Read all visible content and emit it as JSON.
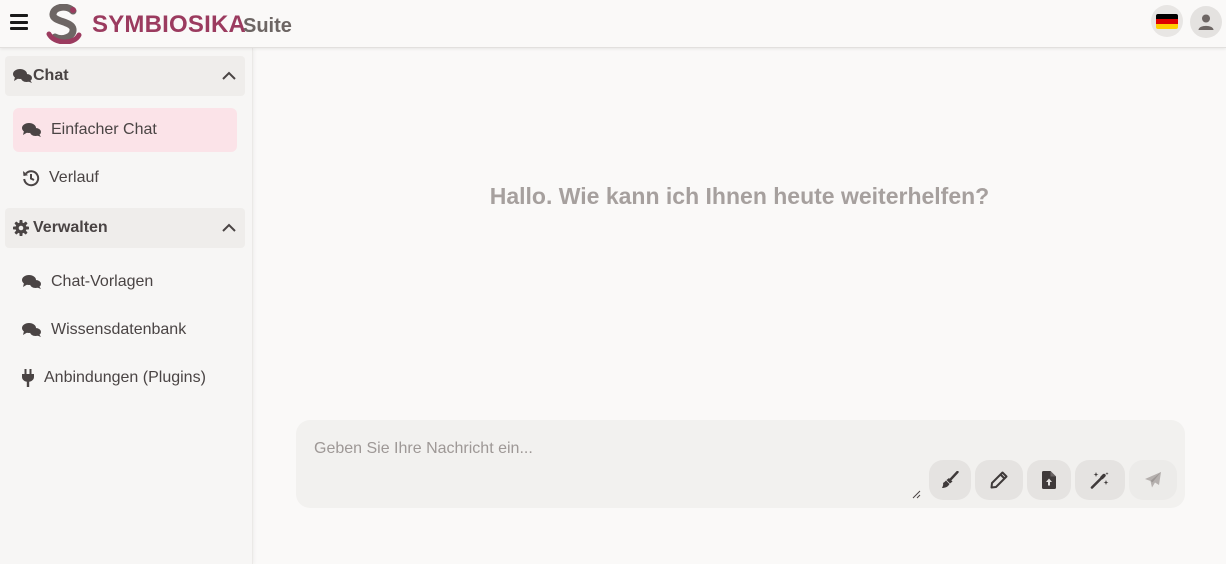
{
  "header": {
    "brand": "SYMBIOSIKA",
    "brand_suffix": "Suite"
  },
  "sidebar": {
    "sections": [
      {
        "label": "Chat",
        "icon": "comments-icon",
        "items": [
          {
            "label": "Einfacher Chat",
            "icon": "comments-icon",
            "active": true
          },
          {
            "label": "Verlauf",
            "icon": "history-icon",
            "active": false
          }
        ]
      },
      {
        "label": "Verwalten",
        "icon": "gear-icon",
        "items": [
          {
            "label": "Chat-Vorlagen",
            "icon": "comments-icon",
            "active": false
          },
          {
            "label": "Wissensdatenbank",
            "icon": "comments-icon",
            "active": false
          },
          {
            "label": "Anbindungen (Plugins)",
            "icon": "plug-icon",
            "active": false
          }
        ]
      }
    ]
  },
  "main": {
    "greeting": "Hallo. Wie kann ich Ihnen heute weiterhelfen?",
    "composer": {
      "placeholder": "Geben Sie Ihre Nachricht ein...",
      "value": "",
      "tools": [
        "broom-icon",
        "pencil-icon",
        "file-upload-icon",
        "magic-wand-icon",
        "send-icon"
      ]
    }
  },
  "colors": {
    "brand": "#9b3b5f",
    "active_item_bg": "#fbe3e8",
    "greeting_text": "#a6a09e"
  }
}
